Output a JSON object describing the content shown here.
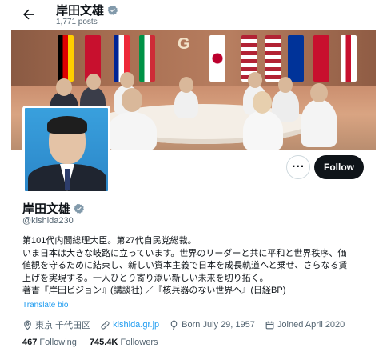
{
  "header": {
    "name": "岸田文雄",
    "posts": "1,771 posts"
  },
  "banner": {
    "logo_text": "G"
  },
  "actions": {
    "more_label": "···",
    "follow_label": "Follow"
  },
  "profile": {
    "name": "岸田文雄",
    "handle": "@kishida230",
    "bio_lines": [
      "第101代内閣総理大臣。第27代自民党総裁。",
      "いま日本は大きな岐路に立っています。世界のリーダーと共に平和と世界秩序、価",
      "値観を守るために結束し、新しい資本主義で日本を成長軌道へと乗せ、さらなる賃",
      "上げを実現する。一人ひとり寄り添い新しい未来を切り拓く。",
      "著書『岸田ビジョン』(講談社) ／『核兵器のない世界へ』(日経BP)"
    ],
    "translate_label": "Translate bio",
    "location": "東京 千代田区",
    "website": "kishida.gr.jp",
    "born": "Born July 29, 1957",
    "joined": "Joined April 2020",
    "following_count": "467",
    "following_label": "Following",
    "followers_count": "745.4K",
    "followers_label": "Followers"
  },
  "colors": {
    "accent": "#1d9bf0",
    "text": "#0f1419",
    "muted": "#536471",
    "follow_bg": "#0f1419"
  },
  "icons": [
    "back-arrow-icon",
    "verified-badge-icon",
    "location-icon",
    "link-icon",
    "balloon-icon",
    "calendar-icon"
  ]
}
